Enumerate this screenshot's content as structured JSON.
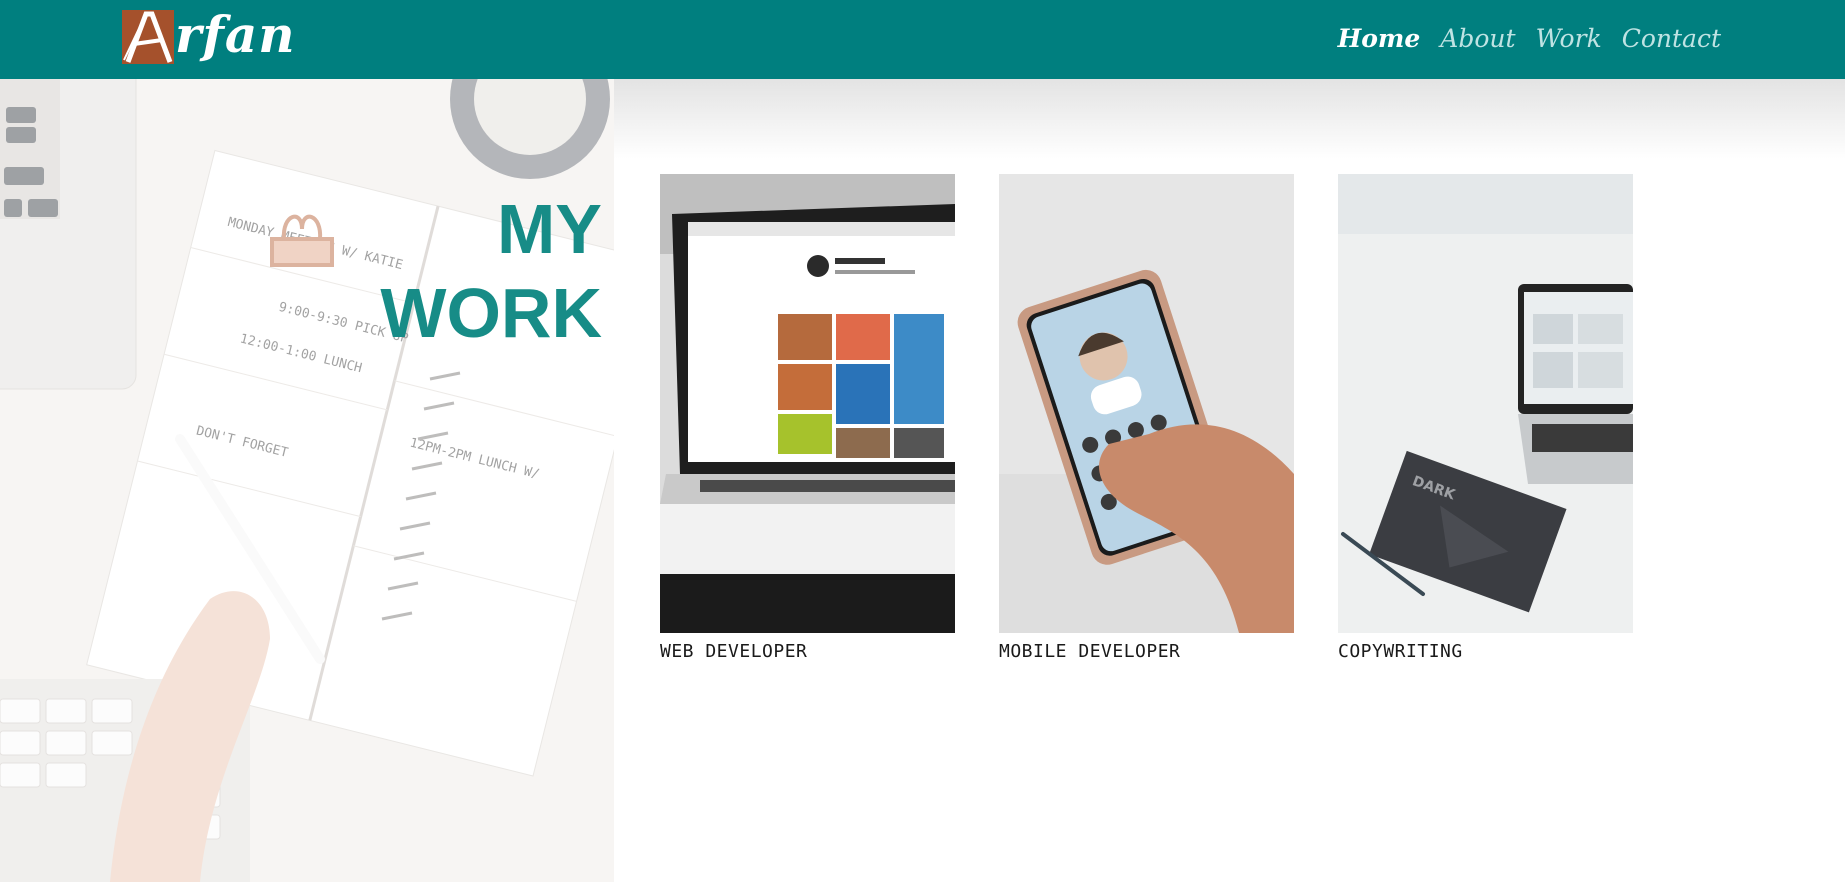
{
  "brand": {
    "logo_text": "rfan",
    "logo_letter": "A"
  },
  "nav": {
    "items": [
      {
        "label": "Home",
        "active": true
      },
      {
        "label": "About",
        "active": false
      },
      {
        "label": "Work",
        "active": false
      },
      {
        "label": "Contact",
        "active": false
      }
    ]
  },
  "hero": {
    "title_line1": "MY",
    "title_line2": "WORK"
  },
  "work": {
    "cards": [
      {
        "label": "WEB DEVELOPER"
      },
      {
        "label": "MOBILE DEVELOPER"
      },
      {
        "label": "COPYWRITING"
      }
    ]
  },
  "colors": {
    "navbar": "#007f7f",
    "accent_title": "#178c87",
    "logo_mark": "#a5512c"
  }
}
